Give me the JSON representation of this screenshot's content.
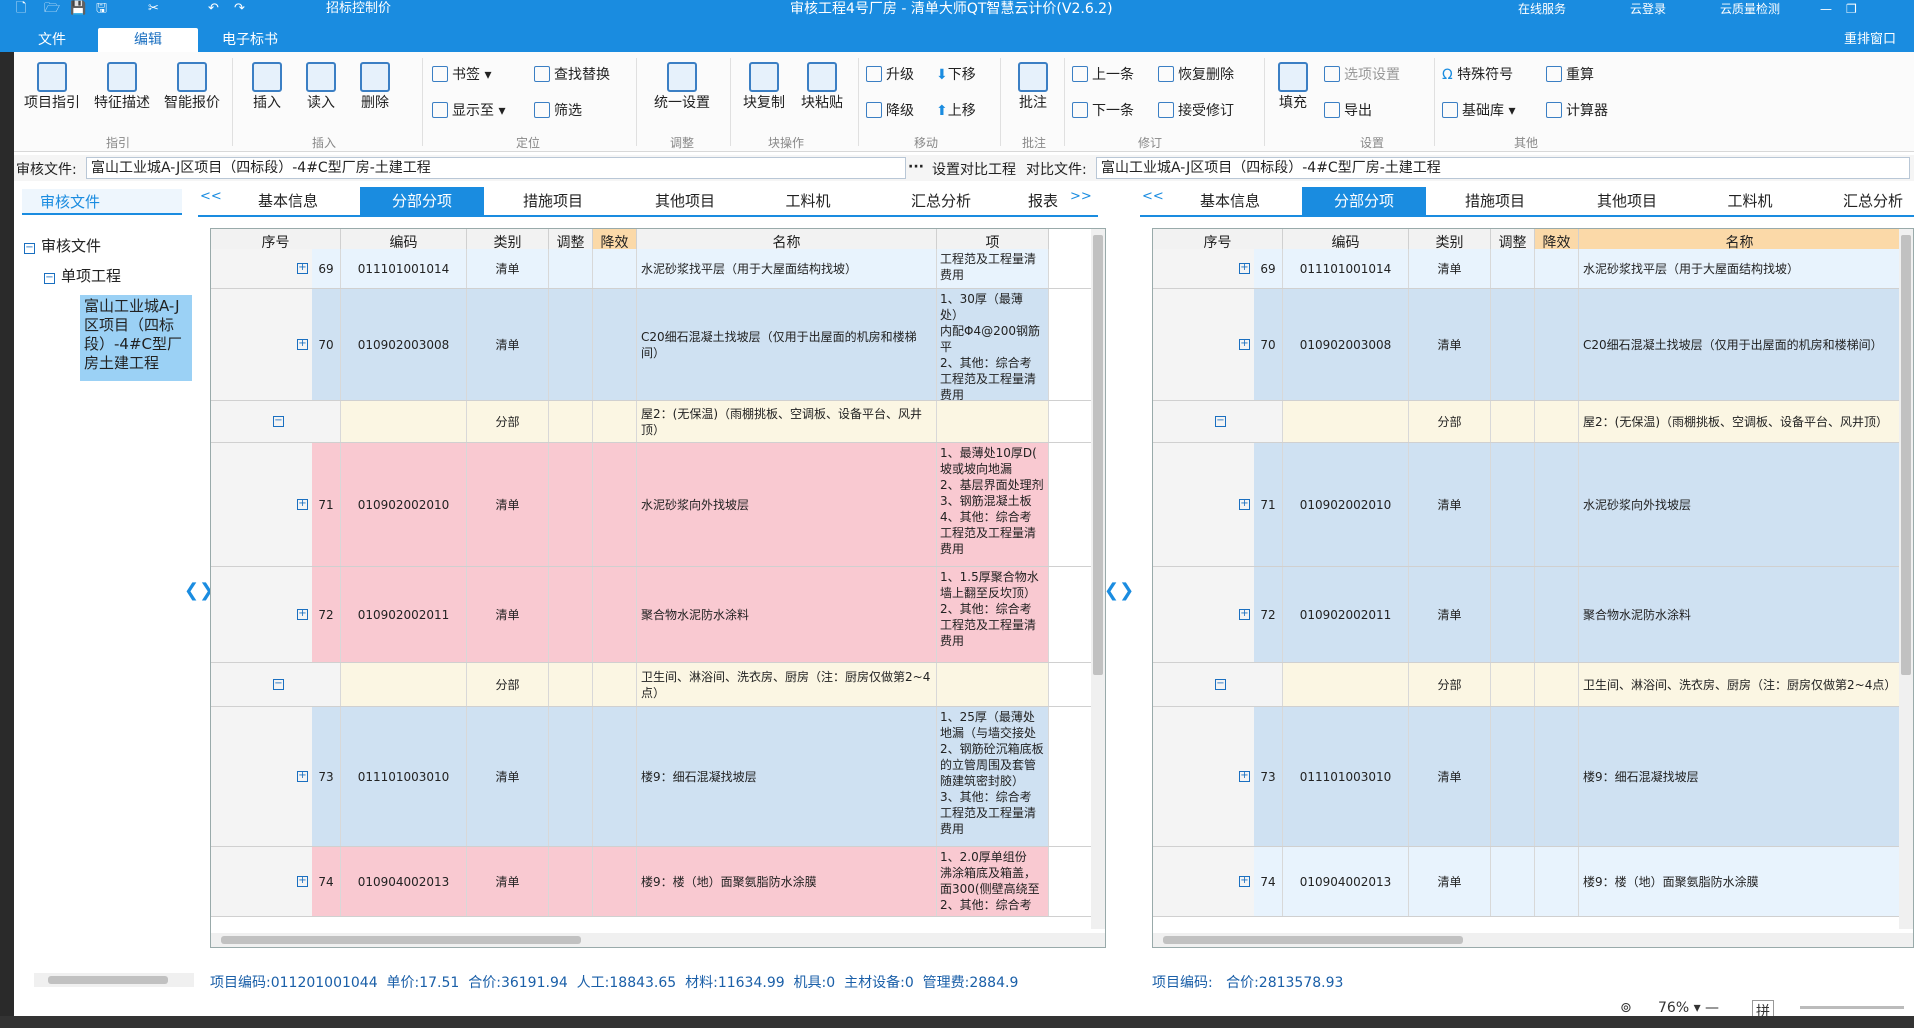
{
  "app": {
    "title": "审核工程4号厂房 - 清单大师QT智慧云计价(V2.6.2)",
    "quick_access_label": "招标控制价",
    "top_right": [
      "在线服务",
      "云登录",
      "云质量检测"
    ],
    "rearrange_label": "重排窗口"
  },
  "menu": {
    "tabs": [
      "文件",
      "编辑",
      "电子标书"
    ],
    "active": "编辑"
  },
  "ribbon": {
    "project_guide": "项目指引",
    "feature_desc": "特征描述",
    "smart_quote": "智能报价",
    "group_guide": "指引",
    "insert": "插入",
    "read_in": "读入",
    "delete": "删除",
    "group_insert": "插入",
    "bookmark": "书签",
    "find_replace": "查找替换",
    "show_to": "显示至",
    "filter": "筛选",
    "group_locate": "定位",
    "unify_settings": "统一设置",
    "group_adjust": "调整",
    "block_copy": "块复制",
    "block_paste": "块粘贴",
    "group_block": "块操作",
    "upgrade": "升级",
    "move_down": "下移",
    "downgrade": "降级",
    "move_up": "上移",
    "group_move": "移动",
    "annotate": "批注",
    "group_annotate": "批注",
    "prev_item": "上一条",
    "restore_delete": "恢复删除",
    "next_item": "下一条",
    "accept_revision": "接受修订",
    "group_revise": "修订",
    "fill": "填充",
    "option_settings": "选项设置",
    "export": "导出",
    "group_settings": "设置",
    "special_symbols": "特殊符号",
    "recalc": "重算",
    "base_library": "基础库",
    "calculator": "计算器",
    "group_other": "其他"
  },
  "filebar": {
    "audit_label": "审核文件:",
    "audit_file": "富山工业城A-J区项目（四标段）-4#C型厂房-土建工程",
    "set_compare": "设置对比工程",
    "compare_label": "对比文件:",
    "compare_file": "富山工业城A-J区项目（四标段）-4#C型厂房-土建工程"
  },
  "tree": {
    "header": "审核文件",
    "root": "审核文件",
    "child": "单项工程",
    "leaf": "富山工业城A-J区项目（四标段）-4#C型厂房土建工程"
  },
  "left_tabs": {
    "prev": "<<",
    "items": [
      "基本信息",
      "分部分项",
      "措施项目",
      "其他项目",
      "工料机",
      "汇总分析",
      "报表"
    ],
    "next": ">>",
    "active": "分部分项"
  },
  "right_tabs": {
    "prev": "<<",
    "items": [
      "基本信息",
      "分部分项",
      "措施项目",
      "其他项目",
      "工料机",
      "汇总分析"
    ],
    "active": "分部分项"
  },
  "left_columns": [
    "序号",
    "编码",
    "类别",
    "调整",
    "降效",
    "名称",
    "项"
  ],
  "right_columns": [
    "序号",
    "编码",
    "类别",
    "调整",
    "降效",
    "名称"
  ],
  "rows": [
    {
      "kind": "qd",
      "seq": "69",
      "code": "011101001014",
      "cat": "清单",
      "name": "水泥砂浆找平层（用于大屋面结构找坡）",
      "feat": "工程范及工程量清\n费用",
      "left_color": "#e8f3fd",
      "right_color": "#e8f3fd"
    },
    {
      "kind": "qd",
      "seq": "70",
      "code": "010902003008",
      "cat": "清单",
      "name": "C20细石混凝土找坡层（仅用于出屋面的机房和楼梯间）",
      "feat": "1、30厚（最薄处）\n内配Φ4@200钢筋\n平\n2、其他：综合考\n工程范及工程量清\n费用",
      "left_color": "#cfe1f2",
      "right_color": "#cfe1f2"
    },
    {
      "kind": "fb",
      "seq": "",
      "code": "",
      "cat": "分部",
      "name": "屋2：(无保温)（雨棚挑板、空调板、设备平台、风井顶）",
      "feat": "",
      "left_color": "#fbf6e3",
      "right_color": "#fbf6e3"
    },
    {
      "kind": "qd",
      "seq": "71",
      "code": "010902002010",
      "cat": "清单",
      "name": "水泥砂浆向外找坡层",
      "feat": "1、最薄处10厚D(\n坡或坡向地漏\n2、基层界面处理剂\n3、钢筋混凝土板\n4、其他：综合考\n工程范及工程量清\n费用",
      "left_color": "#f9c9d1",
      "right_color": "#cfe1f2"
    },
    {
      "kind": "qd",
      "seq": "72",
      "code": "010902002011",
      "cat": "清单",
      "name": "聚合物水泥防水涂料",
      "feat": "1、1.5厚聚合物水\n墙上翻至反坎顶）\n2、其他：综合考\n工程范及工程量清\n费用",
      "left_color": "#f9c9d1",
      "right_color": "#cfe1f2"
    },
    {
      "kind": "fb",
      "seq": "",
      "code": "",
      "cat": "分部",
      "name": "卫生间、淋浴间、洗衣房、厨房（注：厨房仅做第2~4点）",
      "feat": "",
      "left_color": "#fbf6e3",
      "right_color": "#fbf6e3"
    },
    {
      "kind": "qd",
      "seq": "73",
      "code": "011101003010",
      "cat": "清单",
      "name": "楼9：细石混凝找坡层",
      "feat": "1、25厚（最薄处\n地漏（与墙交接处\n2、钢筋砼沉箱底板\n的立管周围及套管\n随建筑密封胶）\n3、其他：综合考\n工程范及工程量清\n费用",
      "left_color": "#cfe1f2",
      "right_color": "#cfe1f2"
    },
    {
      "kind": "qd",
      "seq": "74",
      "code": "010904002013",
      "cat": "清单",
      "name": "楼9：楼（地）面聚氨脂防水涂膜",
      "feat": "1、2.0厚单组份\n沸涂箱底及箱盖，\n面300(侧壁高绕至\n2、其他：综合考",
      "left_color": "#f9c9d1",
      "right_color": "#e8f3fd"
    }
  ],
  "left_status": {
    "code_label": "项目编码:",
    "code": "011201001044",
    "unit_price_label": "单价:",
    "unit_price": "17.51",
    "total_label": "合价:",
    "total": "36191.94",
    "labor_label": "人工:",
    "labor": "18843.65",
    "material_label": "材料:",
    "material": "11634.99",
    "machine_label": "机具:",
    "machine": "0",
    "equip_label": "主材设备:",
    "equip": "0",
    "mgmt_label": "管理费:",
    "mgmt": "2884.9"
  },
  "right_status": {
    "code_label": "项目编码:",
    "total_label": "合价:",
    "total": "2813578.93"
  },
  "zoom": {
    "value": "76%",
    "ime": "拼"
  },
  "colors": {
    "accent": "#1a8ce0",
    "diff_row": "#f9c9d1",
    "normal_row": "#cfe1f2",
    "section_row": "#fbf6e3"
  }
}
